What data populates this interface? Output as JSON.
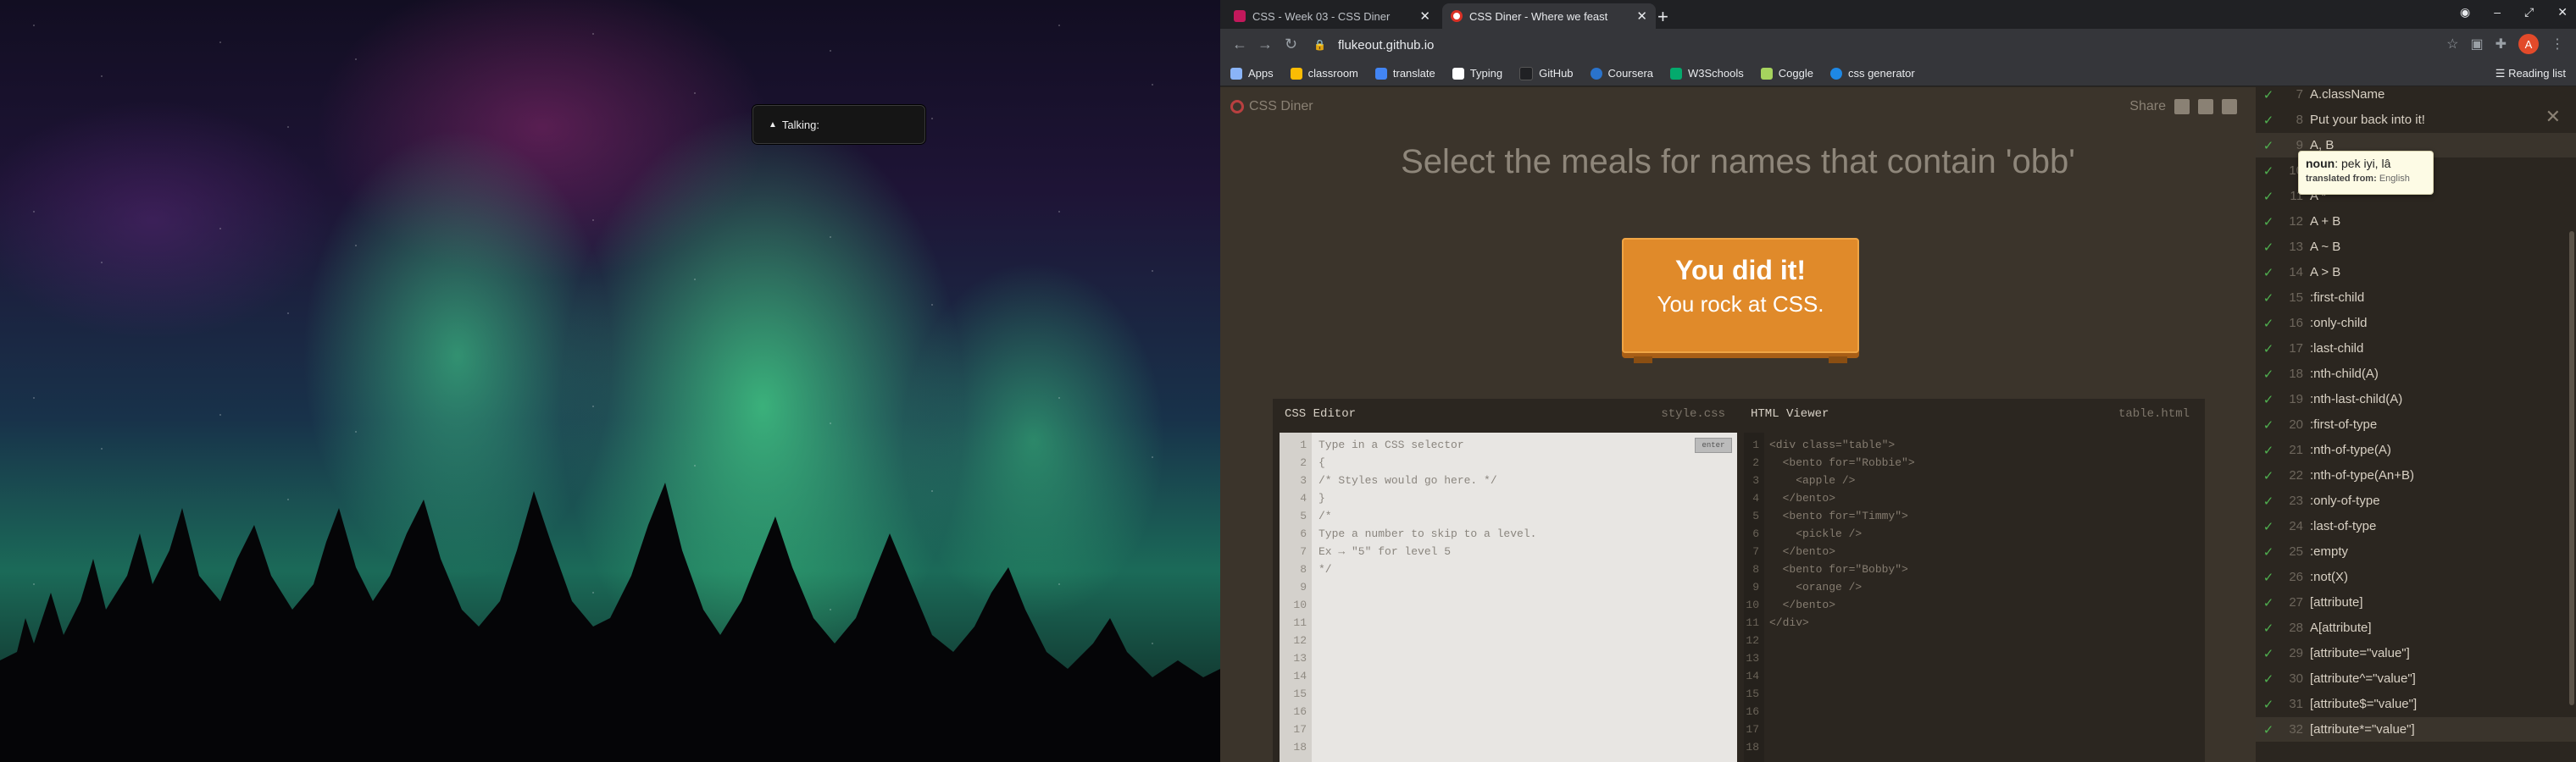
{
  "desktop": {
    "talk_widget": {
      "label": "Talking:"
    }
  },
  "browser": {
    "tabs": [
      {
        "title": "CSS - Week 03 - CSS Diner",
        "favicon_color": "#c2185b",
        "active": false
      },
      {
        "title": "CSS Diner - Where we feast",
        "favicon_color": "#d93025",
        "active": true
      }
    ],
    "url": "flukeout.github.io",
    "avatar_letter": "A",
    "bookmarks": [
      {
        "label": "Apps",
        "icon_color": "#8ab4f8"
      },
      {
        "label": "classroom",
        "icon_color": "#fbbc04"
      },
      {
        "label": "translate",
        "icon_color": "#4285f4"
      },
      {
        "label": "Typing",
        "icon_color": "#ffffff"
      },
      {
        "label": "GitHub",
        "icon_color": "#202124"
      },
      {
        "label": "Coursera",
        "icon_color": "#2a73cc"
      },
      {
        "label": "W3Schools",
        "icon_color": "#04aa6d"
      },
      {
        "label": "Coggle",
        "icon_color": "#a6d35e"
      },
      {
        "label": "css generator",
        "icon_color": "#1e88e5"
      }
    ],
    "reading_list": "Reading list"
  },
  "diner": {
    "logo": "CSS Diner",
    "share": "Share",
    "instruction": "Select the meals for names that contain 'obb'",
    "success_line1": "You did it!",
    "success_line2": "You rock at CSS.",
    "css_editor": {
      "title": "CSS Editor",
      "file": "style.css",
      "enter_label": "enter",
      "line_numbers": [
        "1",
        "2",
        "3",
        "4",
        "5",
        "6",
        "7",
        "8",
        "9",
        "10",
        "11",
        "12",
        "13",
        "14",
        "15",
        "16",
        "17",
        "18"
      ],
      "lines": [
        "Type in a CSS selector",
        "{",
        "/* Styles would go here. */",
        "}",
        "",
        "/*",
        "Type a number to skip to a level.",
        "Ex → \"5\" for level 5",
        "*/"
      ]
    },
    "html_viewer": {
      "title": "HTML Viewer",
      "file": "table.html",
      "line_numbers": [
        "1",
        "2",
        "3",
        "4",
        "5",
        "6",
        "7",
        "8",
        "9",
        "10",
        "11",
        "12",
        "13",
        "14",
        "15",
        "16",
        "17",
        "18"
      ],
      "lines": [
        "<div class=\"table\">",
        "  <bento for=\"Robbie\">",
        "    <apple />",
        "  </bento>",
        "  <bento for=\"Timmy\">",
        "    <pickle />",
        "  </bento>",
        "  <bento for=\"Bobby\">",
        "    <orange />",
        "  </bento>",
        "</div>"
      ]
    },
    "levels": [
      {
        "num": "7",
        "label": "A.className"
      },
      {
        "num": "8",
        "label": "Put your back into it!"
      },
      {
        "num": "9",
        "label": "A, B"
      },
      {
        "num": "10",
        "label": "*"
      },
      {
        "num": "11",
        "label": "A *"
      },
      {
        "num": "12",
        "label": "A + B"
      },
      {
        "num": "13",
        "label": "A ~ B"
      },
      {
        "num": "14",
        "label": "A > B"
      },
      {
        "num": "15",
        "label": ":first-child"
      },
      {
        "num": "16",
        "label": ":only-child"
      },
      {
        "num": "17",
        "label": ":last-child"
      },
      {
        "num": "18",
        "label": ":nth-child(A)"
      },
      {
        "num": "19",
        "label": ":nth-last-child(A)"
      },
      {
        "num": "20",
        "label": ":first-of-type"
      },
      {
        "num": "21",
        "label": ":nth-of-type(A)"
      },
      {
        "num": "22",
        "label": ":nth-of-type(An+B)"
      },
      {
        "num": "23",
        "label": ":only-of-type"
      },
      {
        "num": "24",
        "label": ":last-of-type"
      },
      {
        "num": "25",
        "label": ":empty"
      },
      {
        "num": "26",
        "label": ":not(X)"
      },
      {
        "num": "27",
        "label": "[attribute]"
      },
      {
        "num": "28",
        "label": "A[attribute]"
      },
      {
        "num": "29",
        "label": "[attribute=\"value\"]"
      },
      {
        "num": "30",
        "label": "[attribute^=\"value\"]"
      },
      {
        "num": "31",
        "label": "[attribute$=\"value\"]"
      },
      {
        "num": "32",
        "label": "[attribute*=\"value\"]"
      }
    ],
    "tooltip": {
      "pos": "noun",
      "text": "pek iyi, lâ",
      "from_label": "translated from:",
      "from_lang": "English"
    }
  }
}
